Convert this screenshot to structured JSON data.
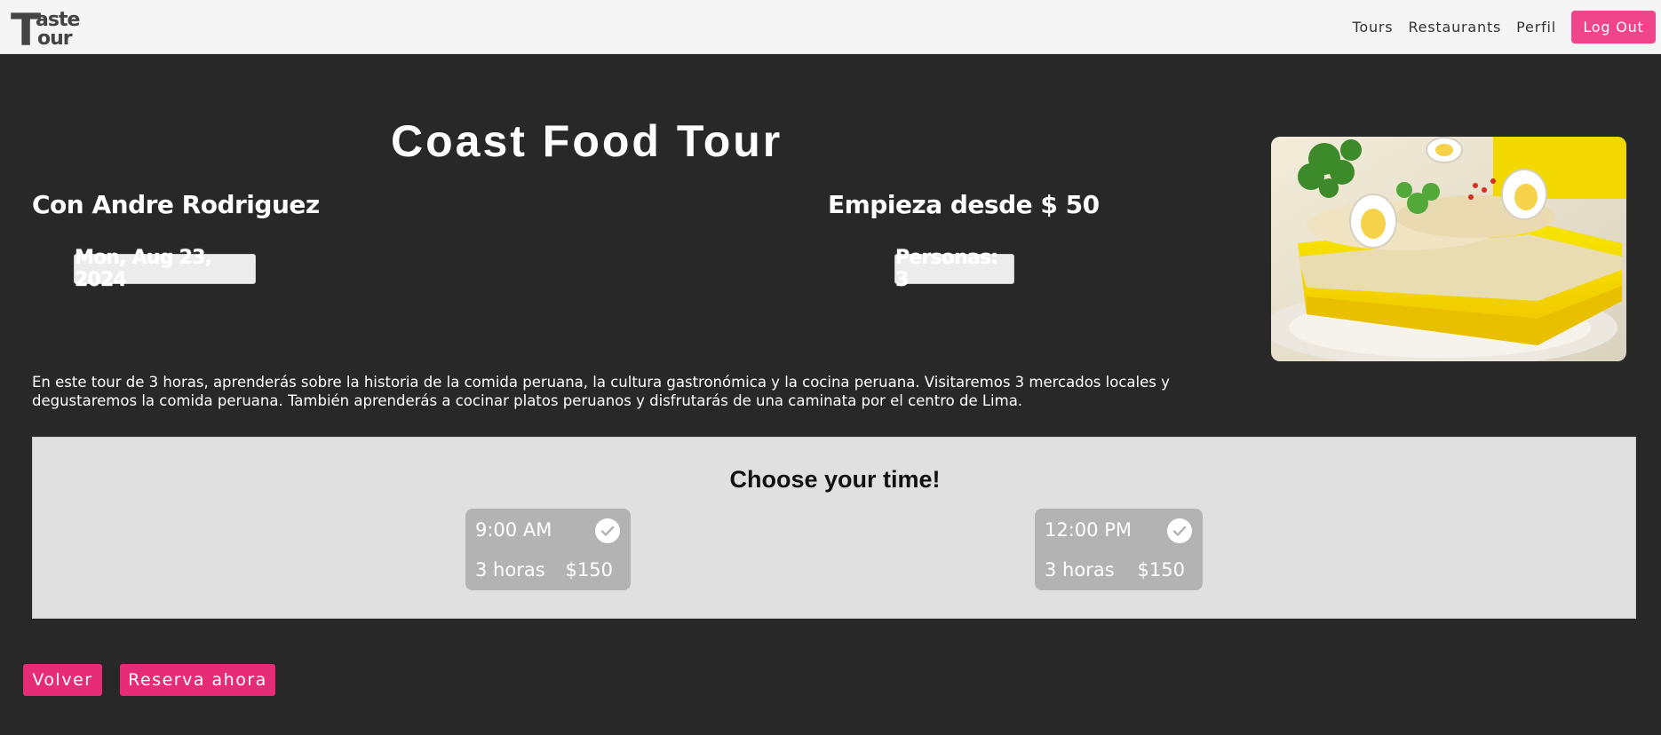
{
  "brand": {
    "logo_text_1": "aste",
    "logo_text_2": "our",
    "logo_letter": "T",
    "color": "#444444"
  },
  "nav": {
    "links": [
      "Tours",
      "Restaurants",
      "Perfil"
    ],
    "logout_label": "Log Out",
    "accent_color": "#f0458b"
  },
  "tour": {
    "title": "Coast Food Tour",
    "guide": "Con Andre Rodriguez",
    "price": "Empieza desde $ 50",
    "date": "Mon, Aug 23, 2024",
    "people": "Personas: 3",
    "description": "En este tour de 3 horas, aprenderás sobre la historia de la comida peruana, la cultura gastronómica y la cocina peruana. Visitaremos 3 mercados locales y degustaremos la comida peruana. También aprenderás a cocinar platos peruanos y disfrutarás de una caminata por el centro de Lima.",
    "image_icon": "causa-dish-photo"
  },
  "times": {
    "heading": "Choose your time!",
    "slots": [
      {
        "time": "9:00 AM",
        "duration": "3 horas",
        "price": "$150",
        "icon": "check-icon"
      },
      {
        "time": "12:00 PM",
        "duration": "3 horas",
        "price": "$150",
        "icon": "check-icon"
      }
    ]
  },
  "actions": {
    "back_label": "Volver",
    "book_label": "Reserva ahora",
    "button_color": "#e72c77"
  }
}
